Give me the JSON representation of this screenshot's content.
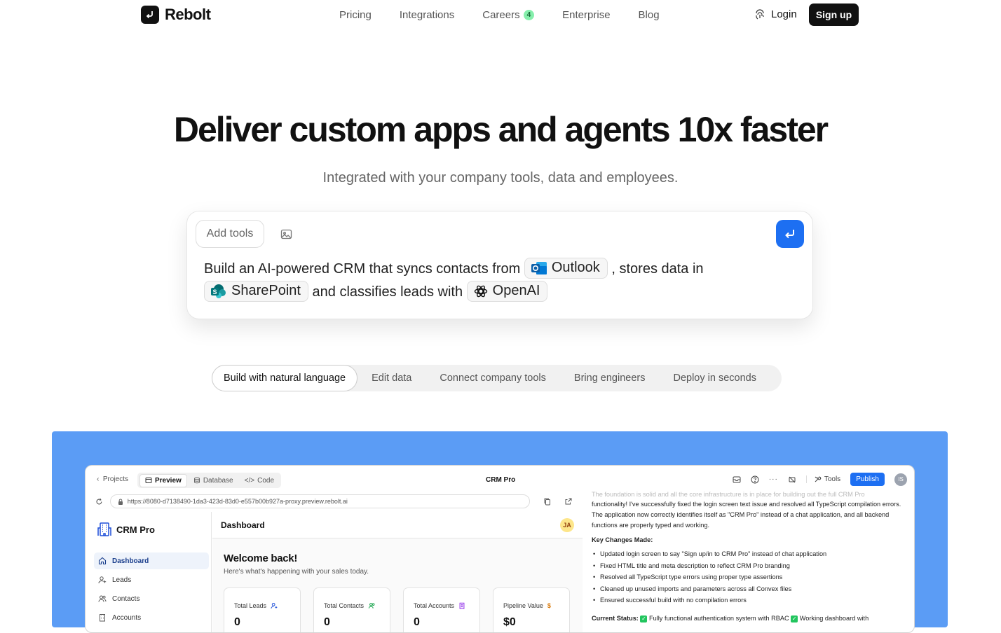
{
  "nav": {
    "brand": "Rebolt",
    "links": [
      {
        "label": "Pricing"
      },
      {
        "label": "Integrations"
      },
      {
        "label": "Careers",
        "badge": "4"
      },
      {
        "label": "Enterprise"
      },
      {
        "label": "Blog"
      }
    ],
    "login": "Login",
    "signup": "Sign up"
  },
  "hero": {
    "title": "Deliver custom apps and agents 10x faster",
    "subtitle": "Integrated with your company tools, data and employees."
  },
  "prompt": {
    "add_tools": "Add tools",
    "t1": "Build an AI-powered CRM that syncs contacts from",
    "chip1": "Outlook",
    "t2": ", stores data in",
    "chip2": "SharePoint",
    "t3": "and classifies leads with",
    "chip3": "OpenAI"
  },
  "tabs": [
    "Build with natural language",
    "Edit data",
    "Connect company tools",
    "Bring engineers",
    "Deploy in seconds"
  ],
  "app": {
    "projects": "Projects",
    "seg": [
      "Preview",
      "Database",
      "Code"
    ],
    "title": "CRM Pro",
    "tools": "Tools",
    "publish": "Publish",
    "avatar": "IS",
    "url": "https://8080-d7138490-1da3-423d-83d0-e557b00b927a-proxy.preview.rebolt.ai",
    "side_brand": "CRM Pro",
    "side_items": [
      "Dashboard",
      "Leads",
      "Contacts",
      "Accounts"
    ],
    "main_title": "Dashboard",
    "user_initials": "JA",
    "welcome": "Welcome back!",
    "welcome_sub": "Here's what's happening with your sales today.",
    "cards": [
      {
        "label": "Total Leads",
        "value": "0"
      },
      {
        "label": "Total Contacts",
        "value": "0"
      },
      {
        "label": "Total Accounts",
        "value": "0"
      },
      {
        "label": "Pipeline Value",
        "value": "$0"
      }
    ],
    "chat": {
      "faded": "The foundation is solid and all the core infrastructure is in place for building out the full CRM Pro",
      "para": "functionality! I've successfully fixed the login screen text issue and resolved all TypeScript compilation errors. The application now correctly identifies itself as \"CRM Pro\" instead of a chat application, and all backend functions are properly typed and working.",
      "heading": "Key Changes Made:",
      "items": [
        "Updated login screen to say \"Sign up/in to CRM Pro\" instead of chat application",
        "Fixed HTML title and meta description to reflect CRM Pro branding",
        "Resolved all TypeScript type errors using proper type assertions",
        "Cleaned up unused imports and parameters across all Convex files",
        "Ensured successful build with no compilation errors"
      ],
      "status_label": "Current Status:",
      "status_1": "Fully functional authentication system with RBAC",
      "status_2": "Working dashboard with"
    }
  }
}
